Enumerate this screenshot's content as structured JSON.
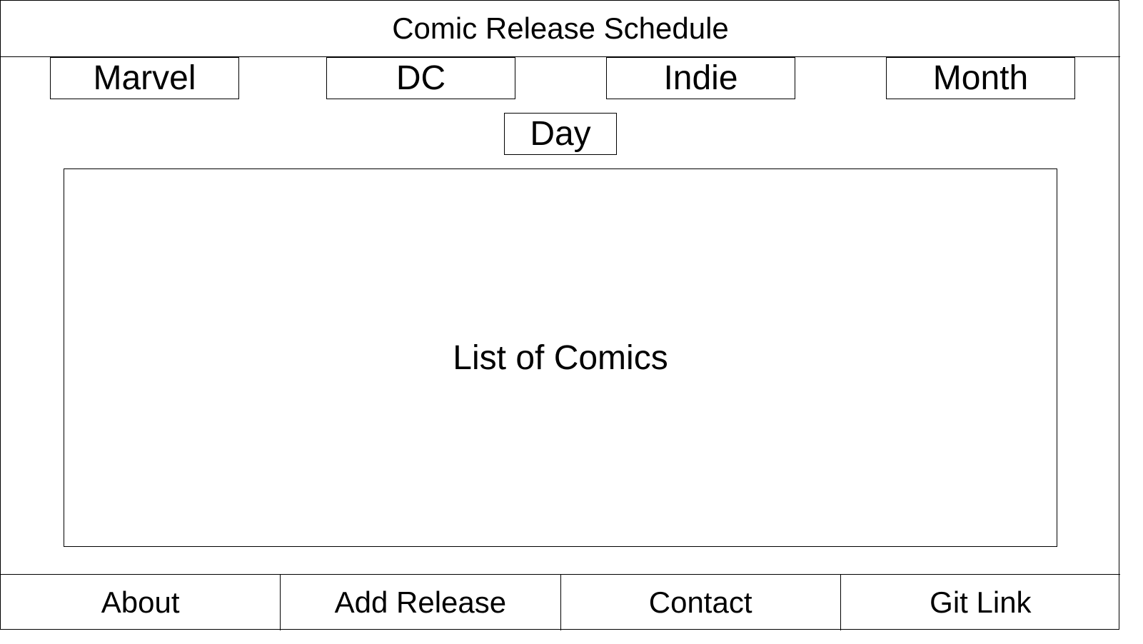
{
  "header": {
    "title": "Comic Release Schedule"
  },
  "filters": {
    "publishers": [
      "Marvel",
      "DC",
      "Indie",
      "Month"
    ],
    "day_label": "Day"
  },
  "main": {
    "placeholder": "List of Comics"
  },
  "footer": {
    "items": [
      "About",
      "Add Release",
      "Contact",
      "Git Link"
    ]
  }
}
